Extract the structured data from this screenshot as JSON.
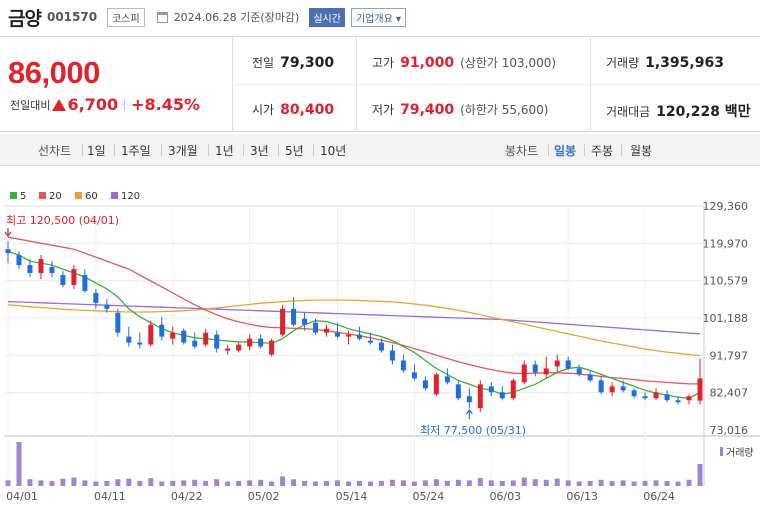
{
  "header": {
    "name": "금양",
    "code": "001570",
    "market": "코스피",
    "date": "2024.06.28 기준(장마감)",
    "live": "실시간",
    "company_info": "기업개요 ▾"
  },
  "price": {
    "current": "86,000",
    "change_label": "전일대비",
    "change": "6,700",
    "change_pct": "+8.45%",
    "prev_close_label": "전일",
    "prev_close": "79,300",
    "open_label": "시가",
    "open": "80,400",
    "high_label": "고가",
    "high": "91,000",
    "upper_limit": "(상한가 103,000)",
    "low_label": "저가",
    "low": "79,400",
    "lower_limit": "(하한가 55,600)",
    "volume_label": "거래량",
    "volume": "1,395,963",
    "amount_label": "거래대금",
    "amount": "120,228 백만"
  },
  "toolbar": {
    "line_chart": "선차트",
    "periods": [
      "1일",
      "1주일",
      "3개월",
      "1년",
      "3년",
      "5년",
      "10년"
    ],
    "candle_chart": "봉차트",
    "candle_types": [
      "일봉",
      "주봉",
      "월봉"
    ],
    "selected_candle": "일봉"
  },
  "colors": {
    "up": "#e0212e",
    "down": "#1e6fd9",
    "ma5": "#3fae3f",
    "ma20": "#e15b5b",
    "ma60": "#e8a23c",
    "ma120": "#9a6ad0",
    "volume": "#a084cf"
  },
  "chart_data": {
    "type": "candlestick",
    "legend": [
      "5",
      "20",
      "60",
      "120"
    ],
    "y_ticks": [
      "129,360",
      "119,970",
      "110,579",
      "101,188",
      "91,797",
      "82,407",
      "73,016"
    ],
    "ylim": [
      73016,
      129360
    ],
    "x_ticks": [
      "04/01",
      "04/11",
      "04/22",
      "05/02",
      "05/14",
      "05/24",
      "06/03",
      "06/13",
      "06/24"
    ],
    "max_label": "최고 120,500 (04/01)",
    "min_label": "최저 77,500 (05/31)",
    "volume_label": "거래량",
    "candles": [
      [
        118500,
        120500,
        115000,
        117500
      ],
      [
        117000,
        118000,
        113500,
        114500
      ],
      [
        114500,
        116000,
        111500,
        112500
      ],
      [
        112500,
        117000,
        111000,
        116000
      ],
      [
        114000,
        115500,
        111500,
        112500
      ],
      [
        112000,
        113000,
        109000,
        109500
      ],
      [
        109500,
        114500,
        108500,
        113500
      ],
      [
        112000,
        113500,
        107500,
        108000
      ],
      [
        107500,
        108500,
        103500,
        105000
      ],
      [
        104500,
        106000,
        102500,
        103500
      ],
      [
        102500,
        103500,
        96500,
        97500
      ],
      [
        96500,
        99000,
        94000,
        95000
      ],
      [
        95000,
        97500,
        93500,
        94500
      ],
      [
        94500,
        100500,
        94000,
        99500
      ],
      [
        99500,
        101500,
        95500,
        96500
      ],
      [
        96000,
        99000,
        94500,
        97500
      ],
      [
        98000,
        98500,
        94500,
        95000
      ],
      [
        95500,
        97500,
        93500,
        94000
      ],
      [
        94500,
        98500,
        94000,
        97500
      ],
      [
        97000,
        98000,
        92500,
        93500
      ],
      [
        93000,
        94500,
        92000,
        93500
      ],
      [
        93000,
        95000,
        92500,
        94500
      ],
      [
        94000,
        97000,
        93000,
        96000
      ],
      [
        96000,
        97000,
        93500,
        94000
      ],
      [
        92000,
        96000,
        91500,
        95500
      ],
      [
        97000,
        104500,
        96500,
        103500
      ],
      [
        103500,
        106500,
        99000,
        99500
      ],
      [
        101000,
        102500,
        98000,
        99500
      ],
      [
        100000,
        101000,
        97000,
        97500
      ],
      [
        97500,
        99500,
        96500,
        98500
      ],
      [
        97500,
        100000,
        96000,
        96500
      ],
      [
        96500,
        98000,
        94500,
        97000
      ],
      [
        97000,
        99000,
        95500,
        96000
      ],
      [
        95500,
        97500,
        94500,
        95000
      ],
      [
        95000,
        96000,
        92500,
        93000
      ],
      [
        93000,
        94500,
        89500,
        90500
      ],
      [
        90500,
        92000,
        87500,
        88000
      ],
      [
        87500,
        89500,
        85500,
        86000
      ],
      [
        85500,
        86500,
        83000,
        83500
      ],
      [
        82000,
        87500,
        81500,
        87000
      ],
      [
        86500,
        88500,
        84500,
        85000
      ],
      [
        84500,
        85500,
        80500,
        81000
      ],
      [
        81500,
        83500,
        78500,
        80000
      ],
      [
        78500,
        85500,
        77500,
        84500
      ],
      [
        84000,
        85000,
        81500,
        82500
      ],
      [
        82500,
        84000,
        80500,
        81000
      ],
      [
        81000,
        86000,
        80500,
        85500
      ],
      [
        85000,
        90500,
        84500,
        89500
      ],
      [
        89500,
        90500,
        86500,
        87500
      ],
      [
        87000,
        91500,
        86000,
        88500
      ],
      [
        89000,
        92000,
        87500,
        90500
      ],
      [
        90500,
        91500,
        88000,
        88500
      ],
      [
        88500,
        89500,
        86500,
        87000
      ],
      [
        87000,
        88000,
        85000,
        85500
      ],
      [
        85500,
        86500,
        82000,
        82500
      ],
      [
        82500,
        85000,
        81500,
        84000
      ],
      [
        84000,
        85500,
        82500,
        83000
      ],
      [
        83000,
        83500,
        81000,
        81500
      ],
      [
        81500,
        82500,
        80500,
        81000
      ],
      [
        81000,
        83500,
        80500,
        82500
      ],
      [
        82000,
        83000,
        80000,
        80500
      ],
      [
        80500,
        81500,
        79500,
        80000
      ],
      [
        80500,
        82000,
        79500,
        81500
      ],
      [
        80400,
        91000,
        79400,
        86000
      ]
    ],
    "volumes": [
      1.0,
      7.8,
      1.2,
      1.0,
      0.9,
      1.3,
      1.5,
      1.0,
      0.8,
      0.9,
      1.2,
      1.3,
      0.9,
      1.4,
      0.8,
      0.9,
      1.0,
      1.1,
      0.9,
      1.2,
      0.8,
      0.9,
      1.0,
      1.1,
      0.8,
      1.7,
      1.2,
      0.9,
      0.8,
      0.9,
      1.0,
      0.8,
      0.9,
      0.8,
      0.9,
      1.1,
      1.0,
      0.8,
      1.0,
      1.2,
      0.9,
      1.1,
      1.0,
      1.4,
      1.0,
      0.9,
      1.0,
      1.5,
      1.2,
      1.1,
      1.3,
      1.0,
      0.8,
      0.9,
      1.1,
      0.9,
      1.0,
      0.8,
      0.9,
      1.0,
      0.9,
      0.8,
      1.1,
      3.9
    ],
    "ma5": [
      118000,
      117000,
      115500,
      115000,
      114500,
      113500,
      112500,
      111500,
      110000,
      108500,
      106500,
      103500,
      101500,
      100000,
      98500,
      97500,
      96800,
      96200,
      96000,
      95700,
      95400,
      95200,
      95100,
      95000,
      94800,
      96000,
      98000,
      99500,
      100500,
      100300,
      99500,
      98500,
      97800,
      97200,
      96500,
      95500,
      94000,
      92500,
      90500,
      88500,
      87000,
      85500,
      84500,
      83500,
      83000,
      82000,
      82500,
      83500,
      84500,
      86000,
      87500,
      88500,
      88800,
      88000,
      87000,
      86000,
      85000,
      84000,
      83000,
      82300,
      81800,
      81300,
      81000,
      82500
    ],
    "ma20": [
      121500,
      121000,
      120500,
      120000,
      119500,
      119000,
      118500,
      117500,
      116500,
      115500,
      114500,
      113500,
      112000,
      110500,
      109000,
      107500,
      106000,
      104500,
      103200,
      102000,
      101000,
      100200,
      99600,
      99100,
      98800,
      98700,
      98600,
      98500,
      98300,
      98000,
      97600,
      97200,
      96700,
      96200,
      95600,
      95000,
      94300,
      93500,
      92700,
      91800,
      91000,
      90200,
      89500,
      88800,
      88200,
      87700,
      87300,
      87200,
      87300,
      87400,
      87400,
      87300,
      87100,
      86800,
      86500,
      86200,
      86000,
      85700,
      85400,
      85200,
      85000,
      84800,
      84600,
      84600
    ],
    "ma60": [
      104500,
      104300,
      104000,
      103800,
      103600,
      103400,
      103200,
      103100,
      103000,
      102900,
      102800,
      102700,
      102700,
      102700,
      102800,
      102900,
      103000,
      103200,
      103400,
      103700,
      104000,
      104300,
      104600,
      104900,
      105100,
      105300,
      105500,
      105600,
      105700,
      105700,
      105700,
      105700,
      105600,
      105500,
      105400,
      105200,
      105000,
      104700,
      104400,
      104000,
      103600,
      103100,
      102600,
      102000,
      101400,
      100800,
      100200,
      99600,
      99000,
      98400,
      97800,
      97200,
      96600,
      96000,
      95400,
      94900,
      94400,
      93900,
      93400,
      93000,
      92600,
      92300,
      92000,
      91700
    ],
    "ma120": [
      105300,
      105200,
      105100,
      105000,
      104900,
      104800,
      104700,
      104600,
      104500,
      104400,
      104300,
      104200,
      104100,
      104000,
      103900,
      103800,
      103700,
      103600,
      103500,
      103400,
      103300,
      103200,
      103100,
      103000,
      102900,
      102800,
      102700,
      102600,
      102500,
      102400,
      102300,
      102200,
      102100,
      102000,
      101900,
      101800,
      101700,
      101600,
      101500,
      101400,
      101300,
      101200,
      101100,
      101000,
      100900,
      100800,
      100600,
      100400,
      100200,
      100000,
      99800,
      99600,
      99400,
      99200,
      99000,
      98800,
      98600,
      98400,
      98200,
      98000,
      97800,
      97600,
      97400,
      97200
    ]
  }
}
